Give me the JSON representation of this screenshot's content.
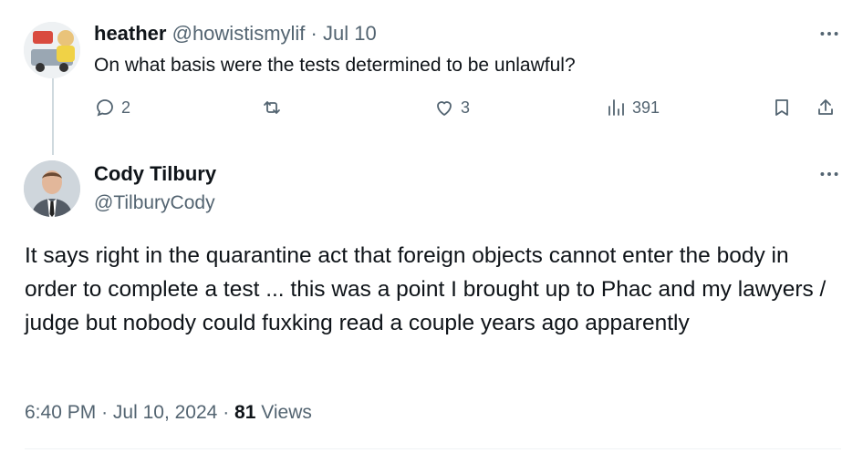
{
  "reply_tweet": {
    "author_name": "heather",
    "author_handle": "@howistismylif",
    "separator": "·",
    "date": "Jul 10",
    "text": "On what basis were the tests determined to be unlawful?",
    "stats": {
      "replies": "2",
      "retweets": "",
      "likes": "3",
      "views": "391"
    },
    "avatar_icon": "profile-avatar-icon"
  },
  "main_tweet": {
    "author_name": "Cody Tilbury",
    "author_handle": "@TilburyCody",
    "text": "It says right in the quarantine act that foreign objects cannot enter the body in order to complete a test ... this was a point I brought up to Phac and my lawyers / judge but nobody could fuxking read a couple years ago apparently",
    "time": "6:40 PM",
    "dot1": "·",
    "date": "Jul 10, 2024",
    "dot2": "·",
    "views_count": "81",
    "views_label": "Views",
    "avatar_icon": "profile-avatar-icon"
  },
  "colors": {
    "text_primary": "#0f1419",
    "text_secondary": "#536471",
    "thread_line": "#cfd9de",
    "background": "#ffffff"
  }
}
